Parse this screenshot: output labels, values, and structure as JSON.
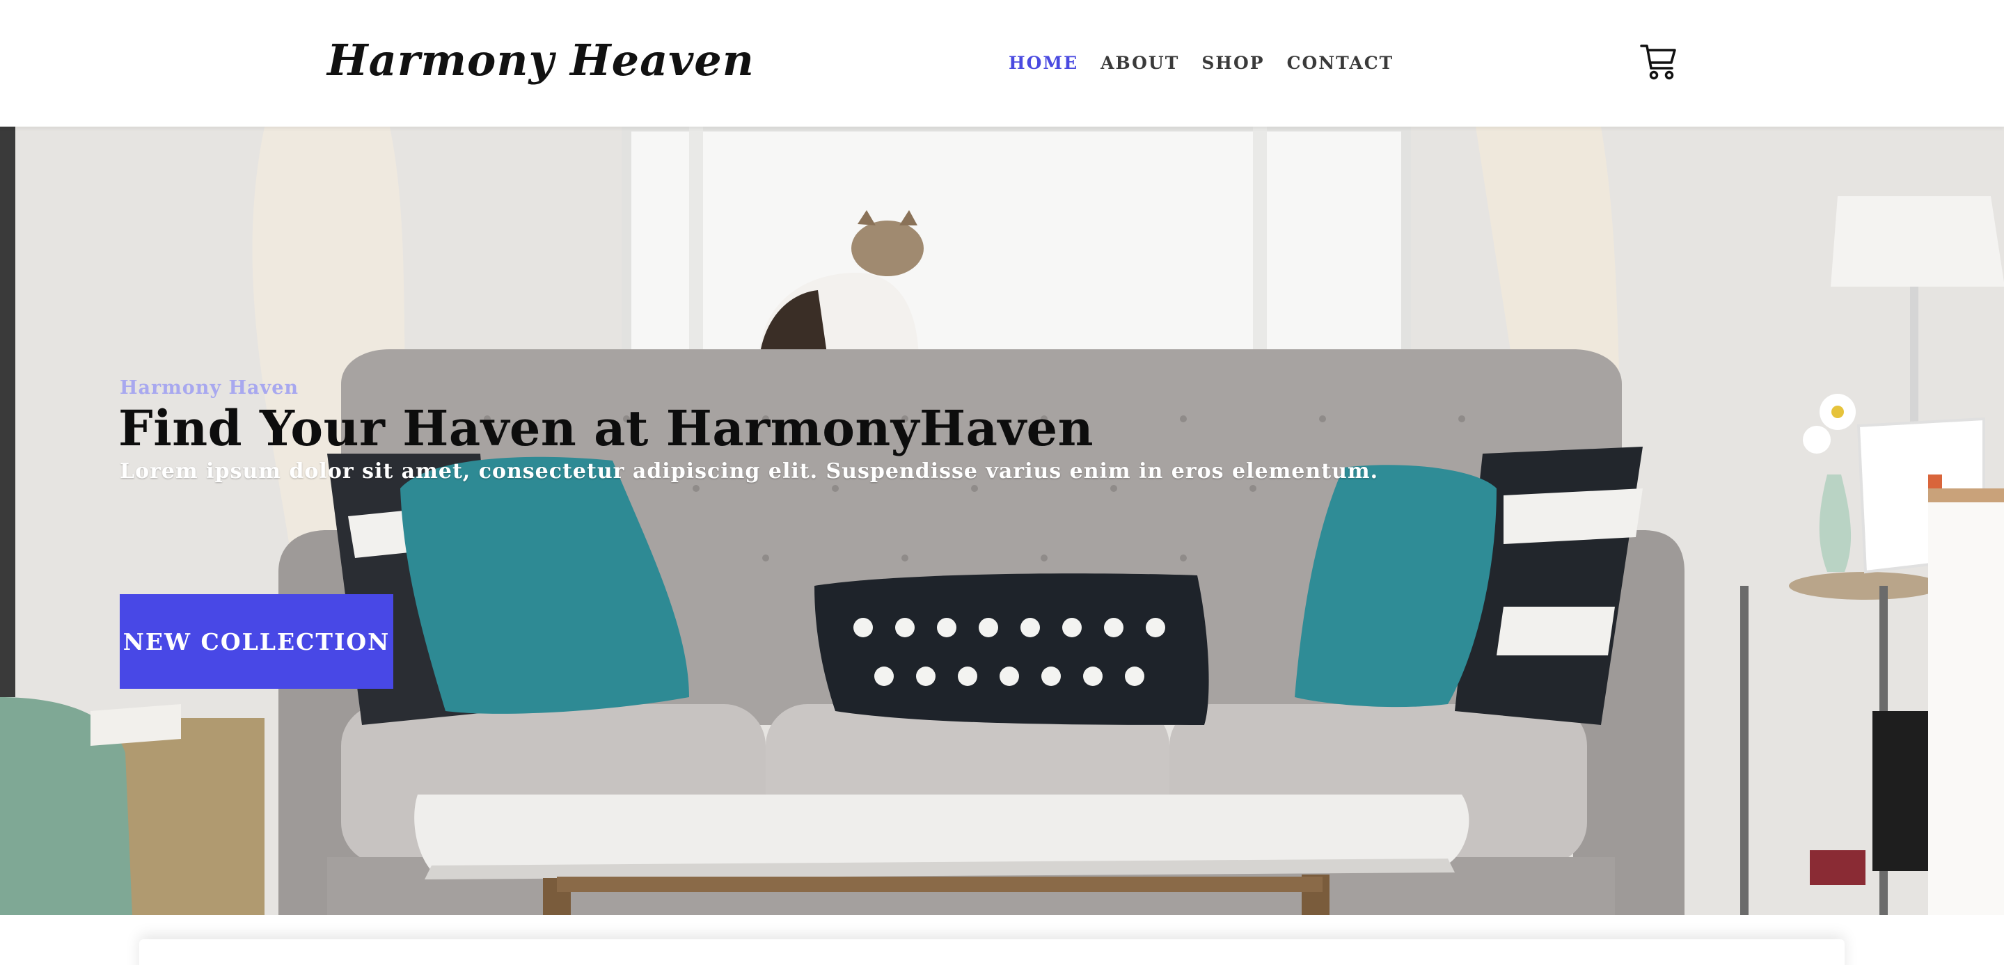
{
  "brand": {
    "name": "Harmony Heaven"
  },
  "nav": {
    "items": [
      {
        "label": "HOME",
        "active": true
      },
      {
        "label": "ABOUT",
        "active": false
      },
      {
        "label": "SHOP",
        "active": false
      },
      {
        "label": "CONTACT",
        "active": false
      }
    ],
    "cart_icon": "shopping-cart-icon"
  },
  "hero": {
    "eyebrow": "Harmony Haven",
    "headline": "Find Your Haven at HarmonyHaven",
    "lede": "Lorem ipsum dolor sit amet, consectetur adipiscing elit. Suspendisse varius enim in eros elementum.",
    "cta_label": "NEW COLLECTION",
    "image": "living-room-sofa-with-cat-photo"
  },
  "colors": {
    "accent": "#4848e6",
    "eyebrow": "#a8a8ef",
    "text_dark": "#0d0d0d"
  }
}
